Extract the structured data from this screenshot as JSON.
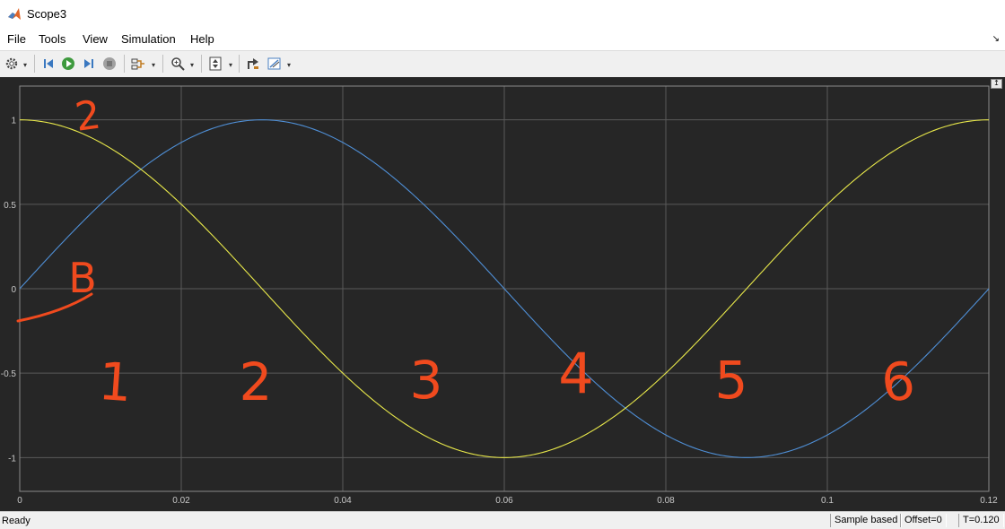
{
  "window": {
    "title": "Scope3"
  },
  "menu": [
    "File",
    "Tools",
    "View",
    "Simulation",
    "Help"
  ],
  "toolbar": {
    "icons": [
      "gear-icon",
      "step-back-icon",
      "run-icon",
      "step-forward-icon",
      "stop-icon",
      "signal-selector-icon",
      "zoom-icon",
      "axes-scaling-icon",
      "highlight-simulink-block-icon",
      "triggers-icon"
    ]
  },
  "plot": {
    "xticks": [
      "0",
      "0.02",
      "0.04",
      "0.06",
      "0.08",
      "0.1",
      "0.12"
    ],
    "yticks": [
      "1",
      "0.5",
      "0",
      "-0.5",
      "-1"
    ],
    "annotations": [
      "2",
      "B",
      "1",
      "2",
      "3",
      "4",
      "5",
      "6"
    ]
  },
  "chart_data": {
    "type": "line",
    "xlim": [
      0,
      0.12
    ],
    "ylim": [
      -1.2,
      1.2
    ],
    "grid": true,
    "series": [
      {
        "color": "#4f8fd6",
        "function": "sin",
        "period": 0.12,
        "x": [
          0,
          0.01,
          0.02,
          0.03,
          0.04,
          0.05,
          0.06,
          0.07,
          0.08,
          0.09,
          0.1,
          0.11,
          0.12
        ],
        "values": [
          0,
          0.5,
          0.866,
          1,
          0.866,
          0.5,
          0,
          -0.5,
          -0.866,
          -1,
          -0.866,
          -0.5,
          0
        ]
      },
      {
        "color": "#e8e84a",
        "function": "cos",
        "period": 0.12,
        "x": [
          0,
          0.01,
          0.02,
          0.03,
          0.04,
          0.05,
          0.06,
          0.07,
          0.08,
          0.09,
          0.1,
          0.11,
          0.12
        ],
        "values": [
          1,
          0.866,
          0.5,
          0,
          -0.5,
          -0.866,
          -1,
          -0.866,
          -0.5,
          0,
          0.5,
          0.866,
          1
        ]
      }
    ]
  },
  "status": {
    "ready": "Ready",
    "mode": "Sample based",
    "offset": "Offset=0",
    "time": "T=0.120"
  },
  "colors": {
    "background": "#262626",
    "grid": "#5a5a5a",
    "annotation": "#f04a1e"
  }
}
